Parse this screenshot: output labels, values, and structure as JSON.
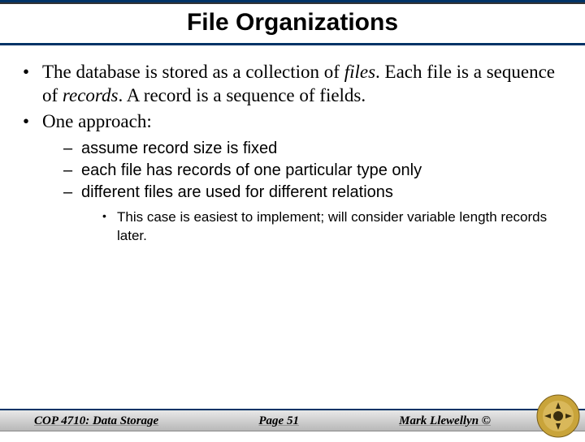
{
  "title": "File Organizations",
  "bullets": {
    "b1_pre": "The database is stored as a collection of ",
    "b1_files": "files",
    "b1_mid": ". Each file is a sequence of ",
    "b1_records": "records",
    "b1_post": ". A record is a sequence of fields.",
    "b2": "One approach:",
    "sub1": "assume record size is fixed",
    "sub2": "each file has records of one particular type only",
    "sub3": "different files are used for different relations",
    "subsub1": "This case is easiest to implement; will consider variable length records later."
  },
  "footer": {
    "left": "COP 4710: Data Storage",
    "center": "Page 51",
    "right": "Mark Llewellyn ©"
  }
}
